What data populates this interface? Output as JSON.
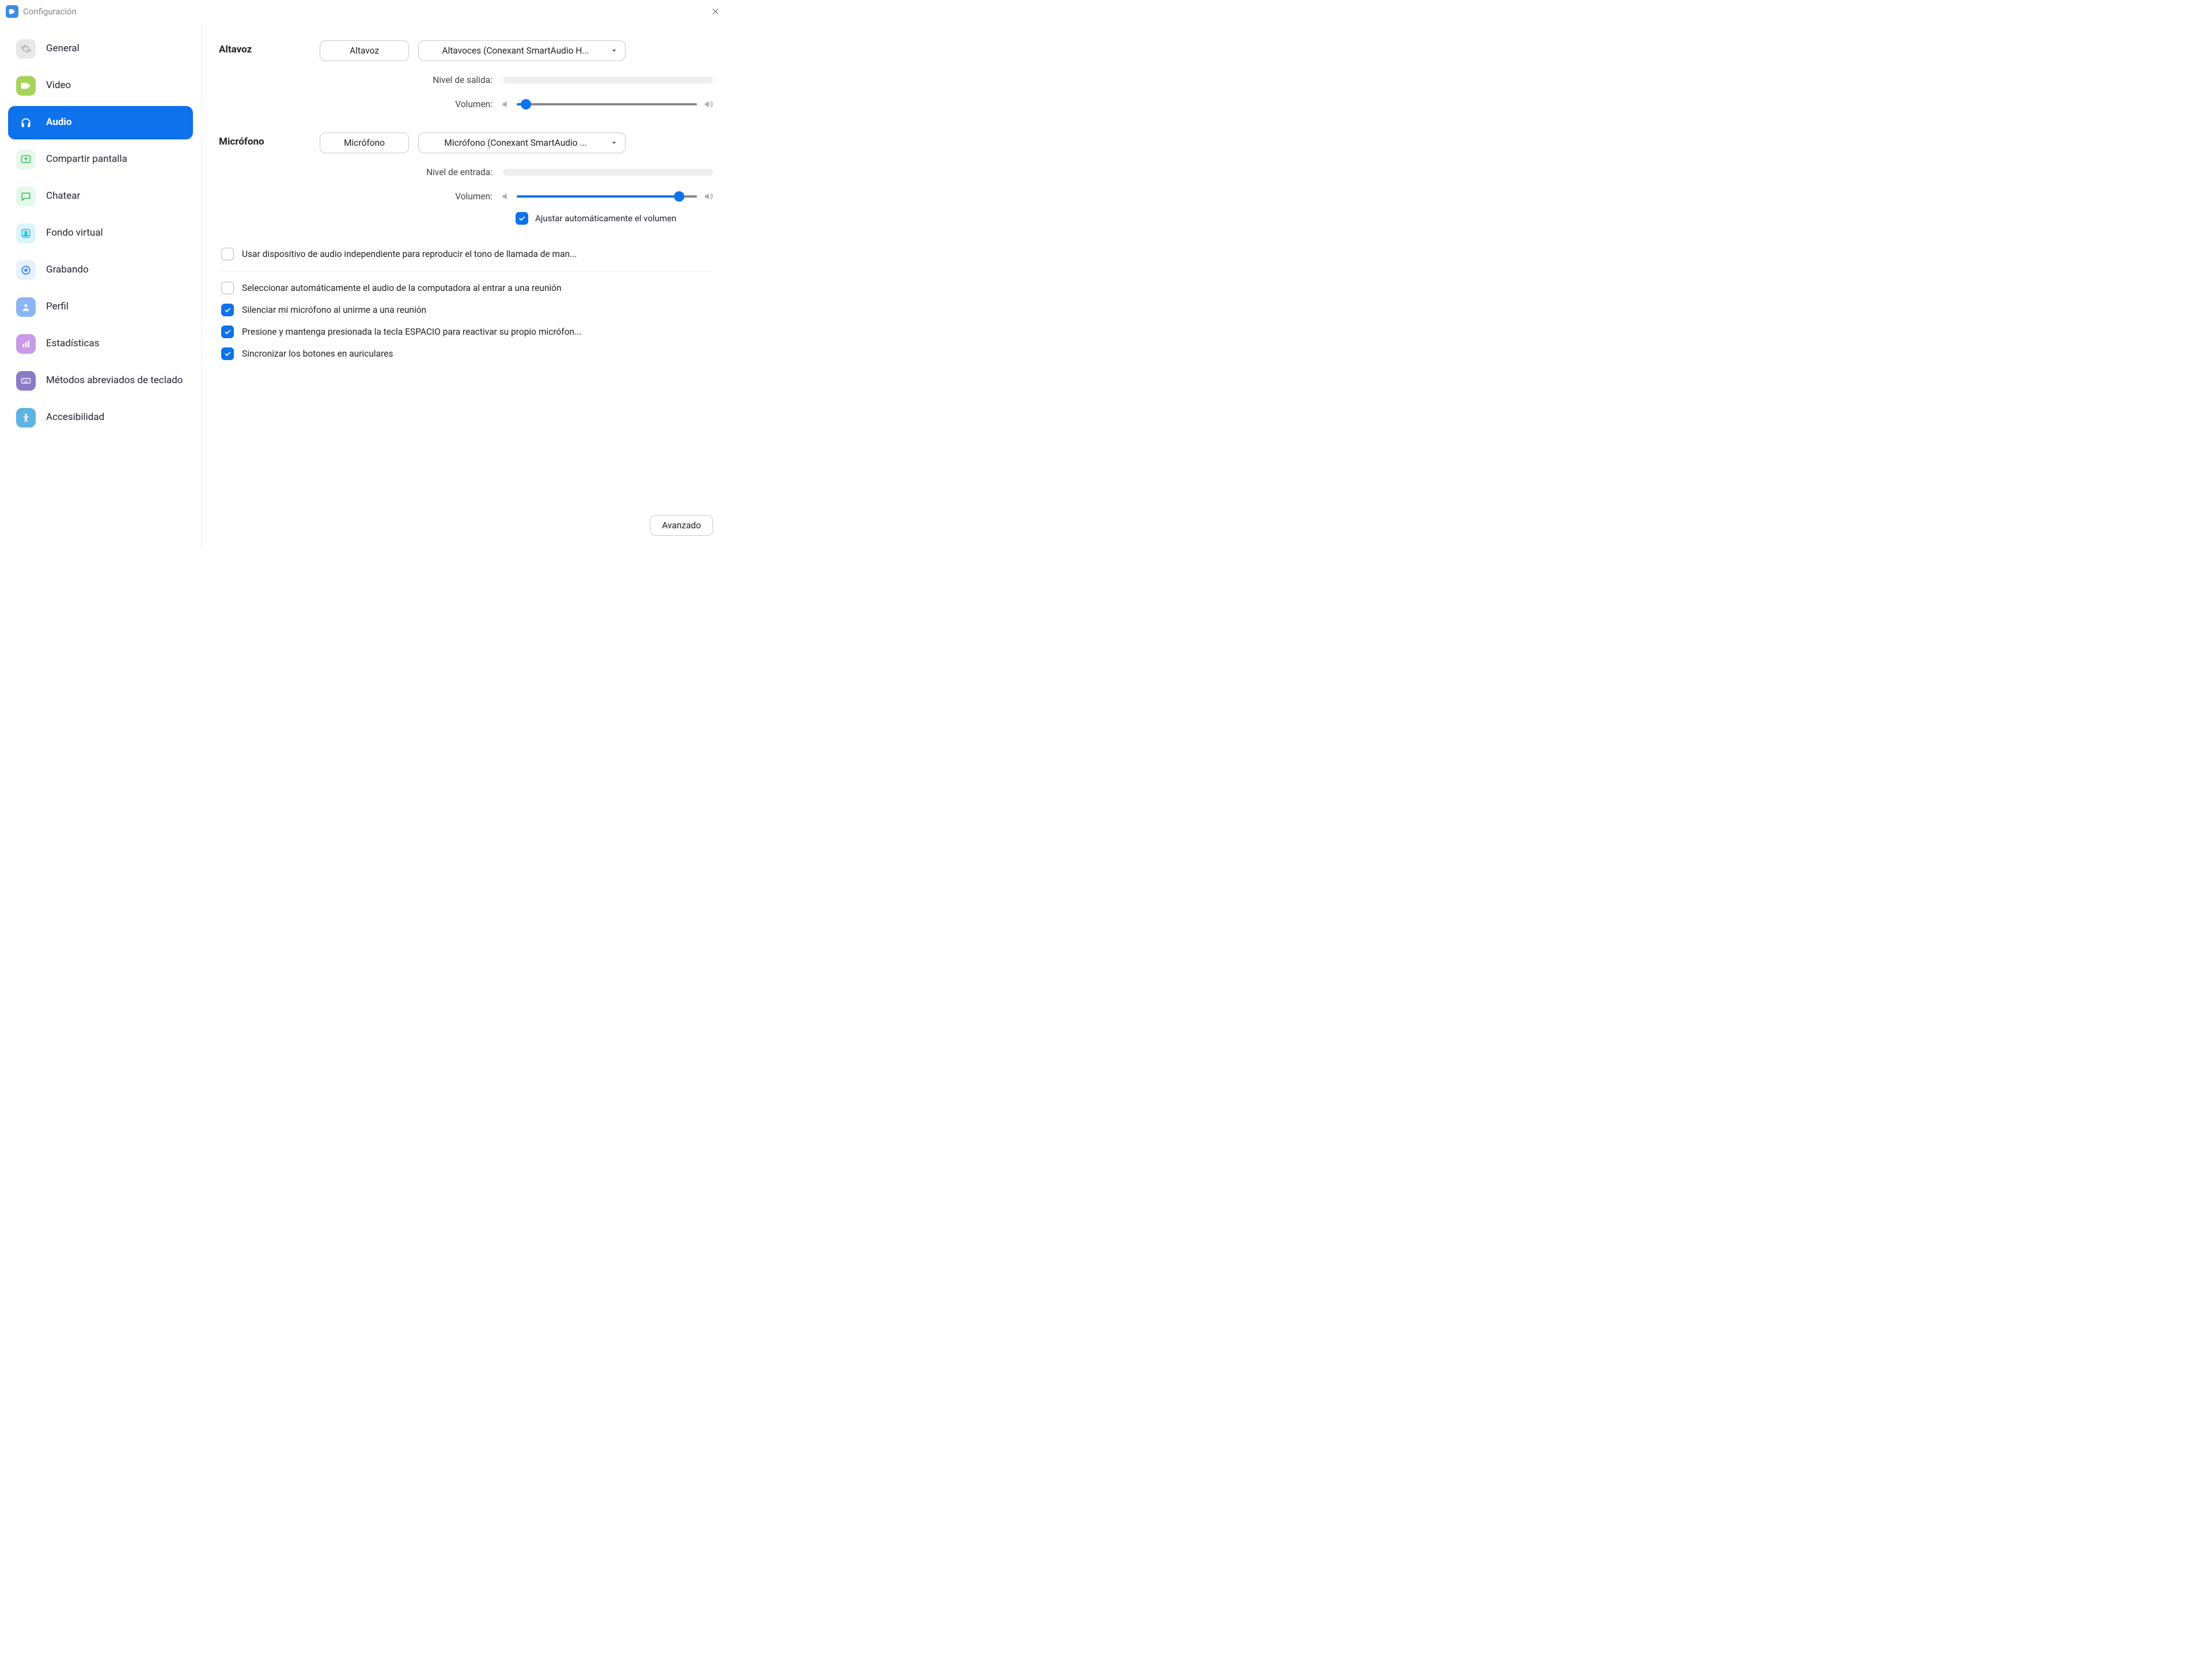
{
  "window": {
    "title": "Configuración"
  },
  "sidebar": {
    "items": [
      {
        "label": "General"
      },
      {
        "label": "Video"
      },
      {
        "label": "Audio"
      },
      {
        "label": "Compartir pantalla"
      },
      {
        "label": "Chatear"
      },
      {
        "label": "Fondo virtual"
      },
      {
        "label": "Grabando"
      },
      {
        "label": "Perfil"
      },
      {
        "label": "Estadísticas"
      },
      {
        "label": "Métodos abreviados de teclado"
      },
      {
        "label": "Accesibilidad"
      }
    ],
    "active_index": 2
  },
  "audio": {
    "speaker": {
      "section_label": "Altavoz",
      "test_button": "Altavoz",
      "selected_device": "Altavoces (Conexant SmartAudio H...",
      "output_level_label": "Nivel de salida:",
      "volume_label": "Volumen:",
      "volume_percent": 5
    },
    "microphone": {
      "section_label": "Micrófono",
      "test_button": "Micrófono",
      "selected_device": "Micrófono (Conexant SmartAudio ...",
      "input_level_label": "Nivel de entrada:",
      "volume_label": "Volumen:",
      "volume_percent": 90,
      "auto_adjust_label": "Ajustar automáticamente el volumen",
      "auto_adjust_checked": true
    },
    "options": [
      {
        "label": "Usar dispositivo de audio independiente para reproducir el tono de llamada de man...",
        "checked": false
      },
      {
        "label": "Seleccionar automáticamente el audio de la computadora al entrar a una reunión",
        "checked": false
      },
      {
        "label": "Silenciar mi micrófono al unirme a una reunión",
        "checked": true
      },
      {
        "label": "Presione y mantenga presionada la tecla ESPACIO para reactivar su propio micrófon...",
        "checked": true
      },
      {
        "label": "Sincronizar los botones en auriculares",
        "checked": true
      }
    ],
    "advanced_button": "Avanzado"
  },
  "colors": {
    "accent": "#0e72ec"
  }
}
